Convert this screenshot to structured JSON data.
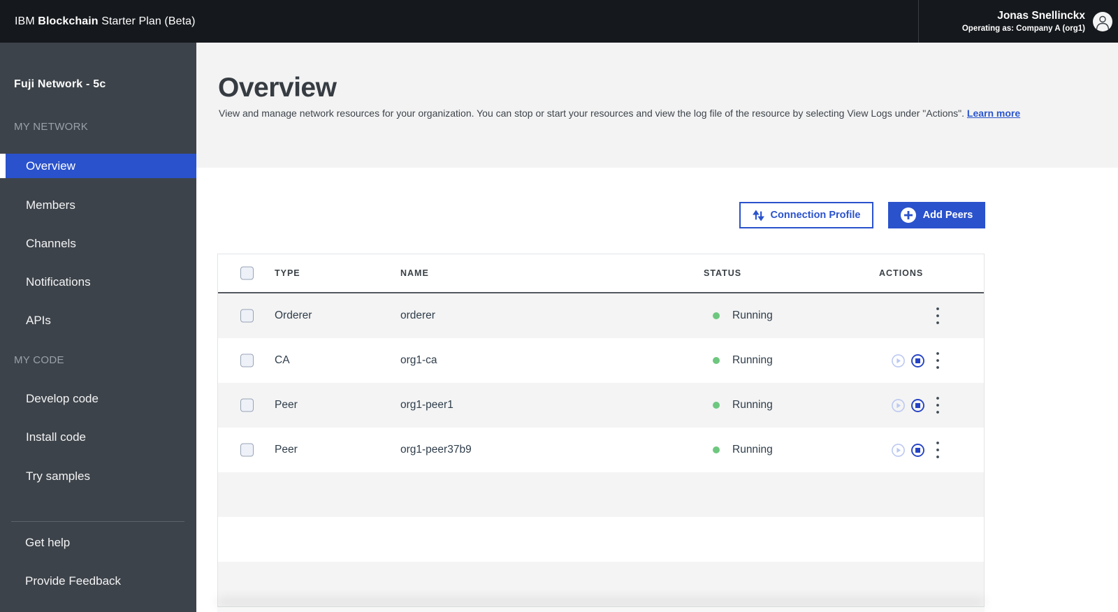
{
  "topbar": {
    "brand_prefix": "IBM ",
    "brand_bold": "Blockchain",
    "brand_suffix": " Starter Plan (Beta)",
    "user": {
      "name": "Jonas Snellinckx",
      "operating_as": "Operating as: Company A (org1)"
    }
  },
  "sidebar": {
    "network_title": "Fuji Network - 5c",
    "section_my_network": "MY NETWORK",
    "section_my_code": "MY CODE",
    "items": [
      {
        "label": "Overview",
        "selected": true
      },
      {
        "label": "Members"
      },
      {
        "label": "Channels"
      },
      {
        "label": "Notifications"
      },
      {
        "label": "APIs"
      },
      {
        "label": "Develop code"
      },
      {
        "label": "Install code"
      },
      {
        "label": "Try samples"
      },
      {
        "label": "Get help"
      },
      {
        "label": "Provide Feedback"
      }
    ]
  },
  "page": {
    "title": "Overview",
    "description": "View and manage network resources for your organization. You can stop or start your resources and view the log file of the resource by selecting View Logs under \"Actions\". ",
    "learn_more": "Learn more"
  },
  "toolbar": {
    "connection_profile_label": "Connection Profile",
    "add_peers_label": "Add Peers"
  },
  "table": {
    "columns": [
      "TYPE",
      "NAME",
      "STATUS",
      "ACTIONS"
    ],
    "rows": [
      {
        "type": "Orderer",
        "name": "orderer",
        "status": "Running"
      },
      {
        "type": "CA",
        "name": "org1-ca",
        "status": "Running"
      },
      {
        "type": "Peer",
        "name": "org1-peer1",
        "status": "Running"
      },
      {
        "type": "Peer",
        "name": "org1-peer37b9",
        "status": "Running"
      }
    ]
  },
  "colors": {
    "accent_blue": "#2a52cc",
    "topbar_bg": "#15181c",
    "sidebar_bg": "#3d434a",
    "band_bg": "#f3f3f3",
    "zebra_gray": "#f4f4f4",
    "status_green": "#6ec77f"
  }
}
